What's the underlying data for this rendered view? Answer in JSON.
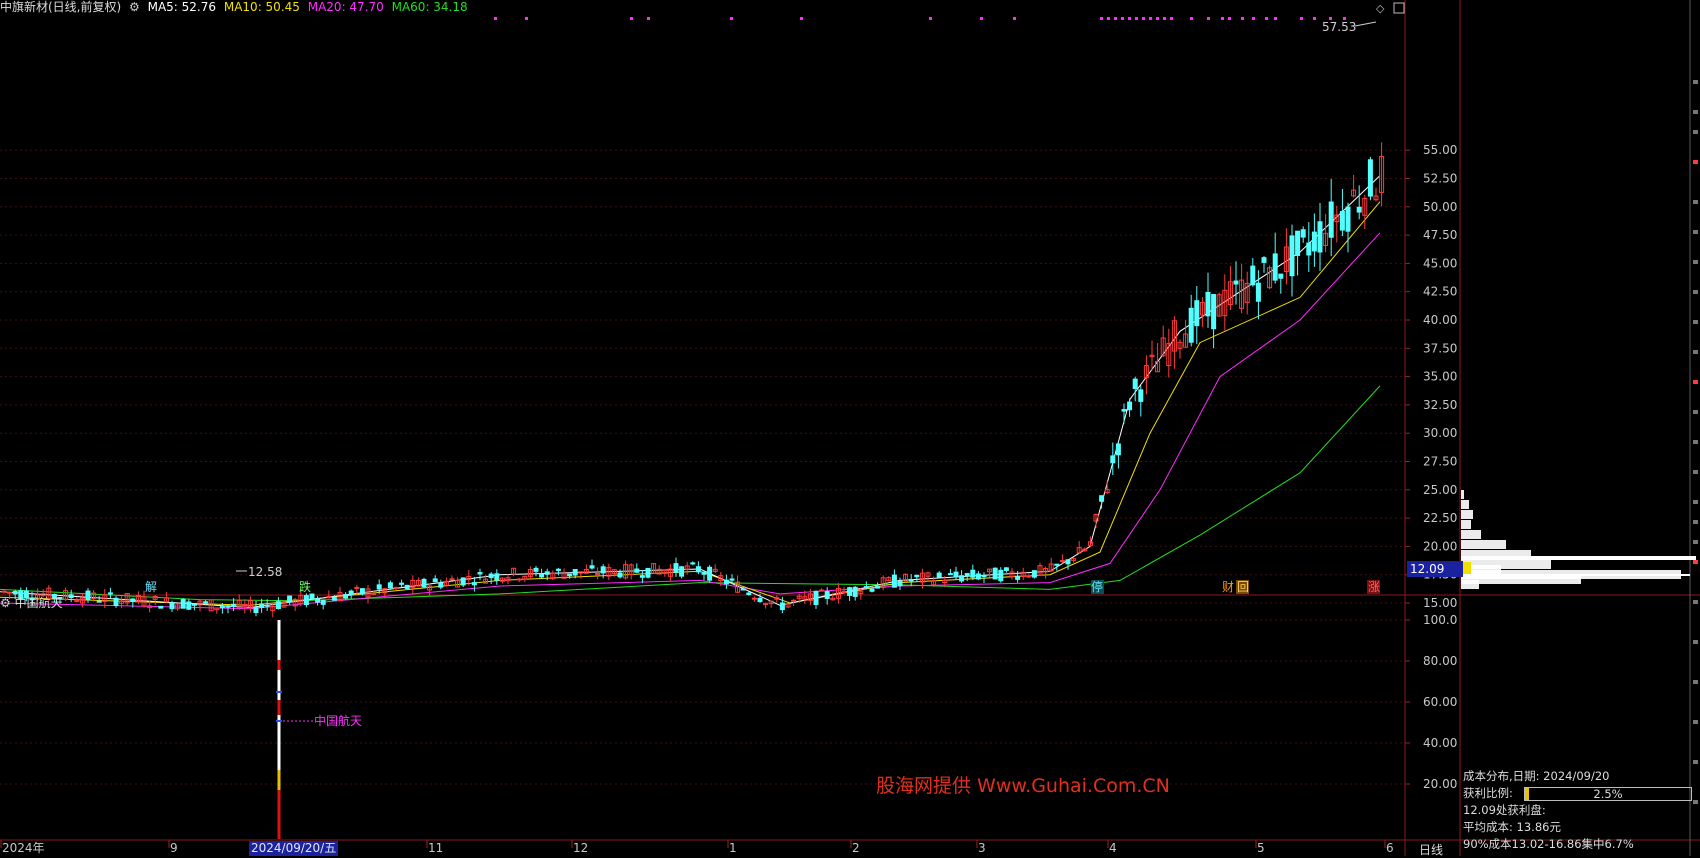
{
  "header": {
    "stock_title": "中旗新材(日线,前复权)",
    "ma5": "MA5: 52.76",
    "ma10": "MA10: 50.45",
    "ma20": "MA20: 47.70",
    "ma60": "MA60: 34.18",
    "colors": {
      "ma5": "#ffffff",
      "ma10": "#f0e000",
      "ma20": "#ff2cff",
      "ma60": "#22dd22"
    }
  },
  "price_axis": {
    "ticks": [
      "55.00",
      "52.50",
      "50.00",
      "47.50",
      "45.00",
      "42.50",
      "40.00",
      "37.50",
      "35.00",
      "32.50",
      "30.00",
      "27.50",
      "25.00",
      "22.50",
      "20.00",
      "17.50",
      "15.00"
    ],
    "cursor_price": "12.09"
  },
  "annotations": {
    "high_label": "57.53",
    "low_label": "12.58",
    "event_markers": [
      "解",
      "跌",
      "停",
      "财",
      "回",
      "涨"
    ]
  },
  "sub_panel": {
    "title": "中国航天",
    "line_label": "中国航天",
    "ticks": [
      "100.0",
      "80.00",
      "60.00",
      "40.00",
      "20.00"
    ]
  },
  "time_axis": {
    "labels": [
      "2024年",
      "9",
      "11",
      "12",
      "1",
      "2",
      "3",
      "4",
      "5",
      "6"
    ],
    "selected_date": "2024/09/20/五",
    "period": "日线"
  },
  "chip_panel": {
    "line1": "成本分布,日期: 2024/09/20",
    "profit_label": "获利比例:",
    "profit_ratio": "2.5%",
    "profit_fraction": 0.025,
    "line3": "12.09处获利盘:",
    "line4": "平均成本: 13.86元",
    "line5": "90%成本13.02-16.86集中6.7%"
  },
  "watermark": "股海网提供 Www.Guhai.Com.CN",
  "chart_data": {
    "type": "candlestick",
    "series": [
      {
        "name": "MA5",
        "color": "#ffffff"
      },
      {
        "name": "MA10",
        "color": "#f0e000"
      },
      {
        "name": "MA20",
        "color": "#ff2cff"
      },
      {
        "name": "MA60",
        "color": "#22dd22"
      }
    ],
    "ylim": [
      12.0,
      57.53
    ],
    "ma60_approx": [
      [
        0,
        16.2
      ],
      [
        200,
        15.3
      ],
      [
        300,
        15.2
      ],
      [
        500,
        15.8
      ],
      [
        700,
        16.8
      ],
      [
        900,
        16.6
      ],
      [
        1050,
        16.2
      ],
      [
        1120,
        17.0
      ],
      [
        1200,
        21.0
      ],
      [
        1300,
        26.5
      ],
      [
        1380,
        34.18
      ]
    ],
    "ma20_approx": [
      [
        0,
        15.0
      ],
      [
        250,
        14.5
      ],
      [
        500,
        16.5
      ],
      [
        700,
        17.0
      ],
      [
        780,
        15.8
      ],
      [
        900,
        16.5
      ],
      [
        1050,
        16.8
      ],
      [
        1110,
        18.5
      ],
      [
        1160,
        25.0
      ],
      [
        1220,
        35.0
      ],
      [
        1300,
        40.0
      ],
      [
        1380,
        47.7
      ]
    ],
    "ma10_approx": [
      [
        0,
        15.5
      ],
      [
        250,
        14.8
      ],
      [
        500,
        17.0
      ],
      [
        700,
        17.8
      ],
      [
        790,
        15.0
      ],
      [
        900,
        16.8
      ],
      [
        1050,
        17.5
      ],
      [
        1100,
        19.5
      ],
      [
        1150,
        30.0
      ],
      [
        1200,
        38.0
      ],
      [
        1300,
        42.0
      ],
      [
        1380,
        50.45
      ]
    ],
    "ma5_approx": [
      [
        0,
        16.0
      ],
      [
        250,
        14.6
      ],
      [
        500,
        17.5
      ],
      [
        700,
        18.0
      ],
      [
        780,
        14.8
      ],
      [
        900,
        17.0
      ],
      [
        1050,
        17.8
      ],
      [
        1090,
        20.0
      ],
      [
        1130,
        33.0
      ],
      [
        1180,
        39.0
      ],
      [
        1300,
        46.0
      ],
      [
        1380,
        52.76
      ]
    ]
  }
}
